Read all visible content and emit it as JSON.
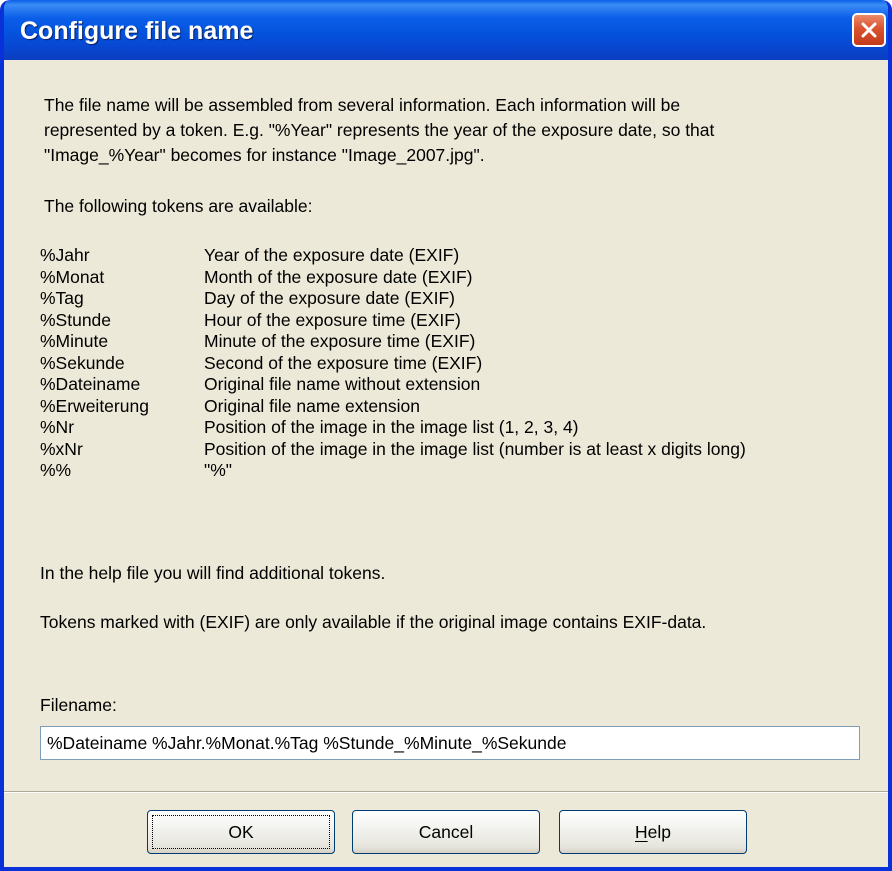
{
  "window": {
    "title": "Configure file name"
  },
  "intro": [
    "The file name will be assembled from several information. Each information will be",
    "represented by a token. E.g. \"%Year\" represents the year of the exposure date, so that",
    "\"Image_%Year\" becomes for instance \"Image_2007.jpg\"."
  ],
  "tokens_heading": "The following tokens are available:",
  "tokens": [
    {
      "token": "%Jahr",
      "description": "Year of the exposure date (EXIF)"
    },
    {
      "token": "%Monat",
      "description": "Month of the exposure date (EXIF)"
    },
    {
      "token": "%Tag",
      "description": "Day of the exposure date (EXIF)"
    },
    {
      "token": "%Stunde",
      "description": "Hour of the exposure time (EXIF)"
    },
    {
      "token": "%Minute",
      "description": "Minute of the exposure time (EXIF)"
    },
    {
      "token": "%Sekunde",
      "description": "Second of the exposure time (EXIF)"
    },
    {
      "token": "%Dateiname",
      "description": "Original file name without extension"
    },
    {
      "token": "%Erweiterung",
      "description": "Original file name extension"
    },
    {
      "token": "%Nr",
      "description": "Position of the image in the image list (1, 2, 3, 4)"
    },
    {
      "token": "%xNr",
      "description": "Position of the image in the image list (number is at least x digits long)"
    },
    {
      "token": "%%",
      "description": "\"%\""
    }
  ],
  "help_text": "In the help file you will find additional tokens.",
  "exif_note": "Tokens marked with (EXIF) are only available if the original image contains EXIF-data.",
  "filename": {
    "label": "Filename:",
    "value": "%Dateiname %Jahr.%Monat.%Tag %Stunde_%Minute_%Sekunde"
  },
  "buttons": {
    "ok": "OK",
    "cancel": "Cancel",
    "help": "Help"
  },
  "icons": {
    "close": "close-icon"
  },
  "colors": {
    "titlebar": "#0a5fe8",
    "dialog_bg": "#ece9d8",
    "close_button": "#d9532f"
  }
}
